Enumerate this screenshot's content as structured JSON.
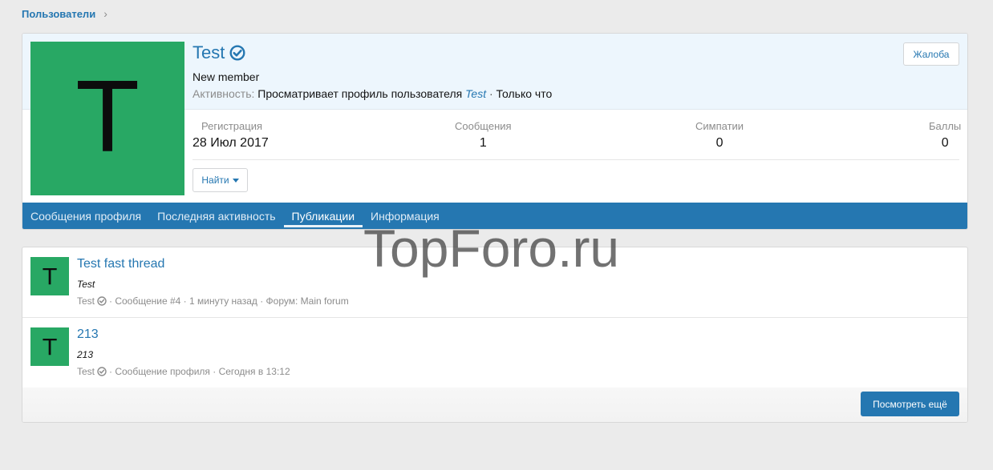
{
  "breadcrumb": {
    "label": "Пользователи"
  },
  "profile": {
    "avatar_letter": "T",
    "username": "Test",
    "user_title": "New member",
    "activity_label": "Активность:",
    "activity_text": "Просматривает профиль пользователя",
    "activity_link": "Test",
    "activity_sep": "·",
    "activity_time": "Только что",
    "report_label": "Жалоба",
    "stats": {
      "registered_label": "Регистрация",
      "registered_value": "28 Июл 2017",
      "messages_label": "Сообщения",
      "messages_value": "1",
      "likes_label": "Симпатии",
      "likes_value": "0",
      "points_label": "Баллы",
      "points_value": "0"
    },
    "find_label": "Найти"
  },
  "tabs": [
    {
      "label": "Сообщения профиля"
    },
    {
      "label": "Последняя активность"
    },
    {
      "label": "Публикации",
      "active": true
    },
    {
      "label": "Информация"
    }
  ],
  "watermark": "TopForo.ru",
  "posts": [
    {
      "avatar_letter": "T",
      "title": "Test fast thread",
      "snippet": "Test",
      "author": "Test",
      "meta": "· Сообщение #4 · 1 минуту назад · Форум: Main forum"
    },
    {
      "avatar_letter": "T",
      "title": "213",
      "snippet": "213",
      "author": "Test",
      "meta": "· Сообщение профиля · Сегодня в 13:12"
    }
  ],
  "more_label": "Посмотреть ещё",
  "colors": {
    "accent": "#2577b1",
    "avatar_bg": "#28a864",
    "header_bg": "#edf6fd",
    "page_bg": "#ebebeb"
  }
}
